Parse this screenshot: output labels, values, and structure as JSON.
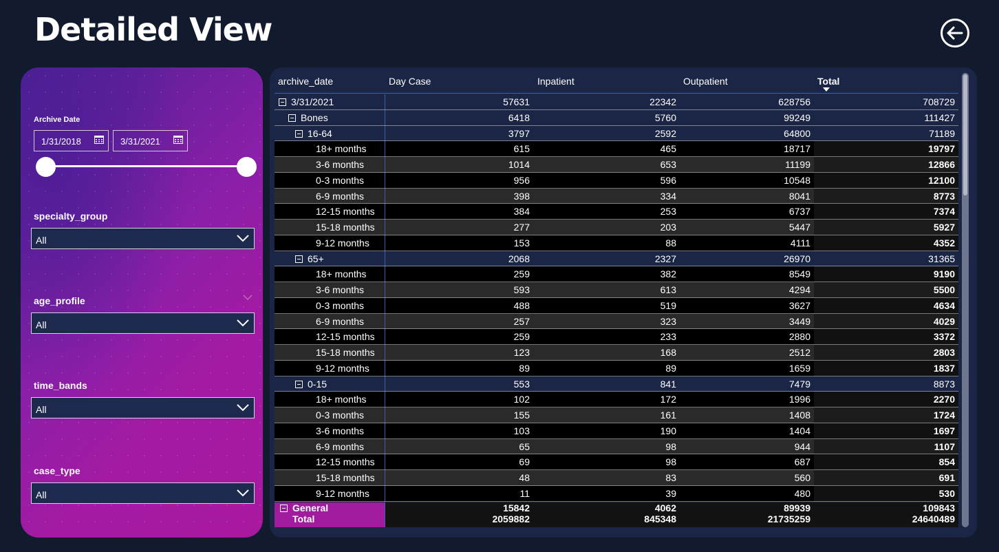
{
  "page": {
    "title": "Detailed View"
  },
  "filters": {
    "archive_date": {
      "label": "Archive Date",
      "start": "1/31/2018",
      "end": "3/31/2021"
    },
    "slicers": [
      {
        "label": "specialty_group",
        "value": "All"
      },
      {
        "label": "age_profile",
        "value": "All"
      },
      {
        "label": "time_bands",
        "value": "All"
      },
      {
        "label": "case_type",
        "value": "All"
      }
    ]
  },
  "table": {
    "headers": [
      "archive_date",
      "Day Case",
      "Inpatient",
      "Outpatient",
      "Total"
    ],
    "rows": [
      {
        "level": 0,
        "type": "group",
        "label": "3/31/2021",
        "values": [
          "57631",
          "22342",
          "628756",
          "708729"
        ]
      },
      {
        "level": 1,
        "type": "group",
        "label": "Bones",
        "values": [
          "6418",
          "5760",
          "99249",
          "111427"
        ]
      },
      {
        "level": 2,
        "type": "group",
        "label": "16-64",
        "values": [
          "3797",
          "2592",
          "64800",
          "71189"
        ]
      },
      {
        "level": 3,
        "type": "leaf",
        "label": "18+ months",
        "values": [
          "615",
          "465",
          "18717",
          "19797"
        ]
      },
      {
        "level": 3,
        "type": "leaf",
        "label": "3-6 months",
        "values": [
          "1014",
          "653",
          "11199",
          "12866"
        ]
      },
      {
        "level": 3,
        "type": "leaf",
        "label": "0-3 months",
        "values": [
          "956",
          "596",
          "10548",
          "12100"
        ]
      },
      {
        "level": 3,
        "type": "leaf",
        "label": "6-9 months",
        "values": [
          "398",
          "334",
          "8041",
          "8773"
        ]
      },
      {
        "level": 3,
        "type": "leaf",
        "label": "12-15 months",
        "values": [
          "384",
          "253",
          "6737",
          "7374"
        ]
      },
      {
        "level": 3,
        "type": "leaf",
        "label": "15-18 months",
        "values": [
          "277",
          "203",
          "5447",
          "5927"
        ]
      },
      {
        "level": 3,
        "type": "leaf",
        "label": "9-12 months",
        "values": [
          "153",
          "88",
          "4111",
          "4352"
        ]
      },
      {
        "level": 2,
        "type": "group",
        "label": "65+",
        "values": [
          "2068",
          "2327",
          "26970",
          "31365"
        ]
      },
      {
        "level": 3,
        "type": "leaf",
        "label": "18+ months",
        "values": [
          "259",
          "382",
          "8549",
          "9190"
        ]
      },
      {
        "level": 3,
        "type": "leaf",
        "label": "3-6 months",
        "values": [
          "593",
          "613",
          "4294",
          "5500"
        ]
      },
      {
        "level": 3,
        "type": "leaf",
        "label": "0-3 months",
        "values": [
          "488",
          "519",
          "3627",
          "4634"
        ]
      },
      {
        "level": 3,
        "type": "leaf",
        "label": "6-9 months",
        "values": [
          "257",
          "323",
          "3449",
          "4029"
        ]
      },
      {
        "level": 3,
        "type": "leaf",
        "label": "12-15 months",
        "values": [
          "259",
          "233",
          "2880",
          "3372"
        ]
      },
      {
        "level": 3,
        "type": "leaf",
        "label": "15-18 months",
        "values": [
          "123",
          "168",
          "2512",
          "2803"
        ]
      },
      {
        "level": 3,
        "type": "leaf",
        "label": "9-12 months",
        "values": [
          "89",
          "89",
          "1659",
          "1837"
        ]
      },
      {
        "level": 2,
        "type": "group",
        "label": "0-15",
        "values": [
          "553",
          "841",
          "7479",
          "8873"
        ]
      },
      {
        "level": 3,
        "type": "leaf",
        "label": "18+ months",
        "values": [
          "102",
          "172",
          "1996",
          "2270"
        ]
      },
      {
        "level": 3,
        "type": "leaf",
        "label": "0-3 months",
        "values": [
          "155",
          "161",
          "1408",
          "1724"
        ]
      },
      {
        "level": 3,
        "type": "leaf",
        "label": "3-6 months",
        "values": [
          "103",
          "190",
          "1404",
          "1697"
        ]
      },
      {
        "level": 3,
        "type": "leaf",
        "label": "6-9 months",
        "values": [
          "65",
          "98",
          "944",
          "1107"
        ]
      },
      {
        "level": 3,
        "type": "leaf",
        "label": "12-15 months",
        "values": [
          "69",
          "98",
          "687",
          "854"
        ]
      },
      {
        "level": 3,
        "type": "leaf",
        "label": "15-18 months",
        "values": [
          "48",
          "83",
          "560",
          "691"
        ]
      },
      {
        "level": 3,
        "type": "leaf",
        "label": "9-12 months",
        "values": [
          "11",
          "39",
          "480",
          "530"
        ]
      }
    ],
    "partial_row": {
      "label": "General",
      "values": [
        "15842",
        "4062",
        "89939",
        "109843"
      ]
    },
    "total_row": {
      "label": "Total",
      "values": [
        "2059882",
        "845348",
        "21735259",
        "24640489"
      ]
    }
  },
  "colors": {
    "background": "#121a2e",
    "panel": "#1b2646",
    "accent_magenta": "#a01b9e",
    "filter_gradient_start": "#4a2092",
    "filter_gradient_end": "#a8199f"
  }
}
